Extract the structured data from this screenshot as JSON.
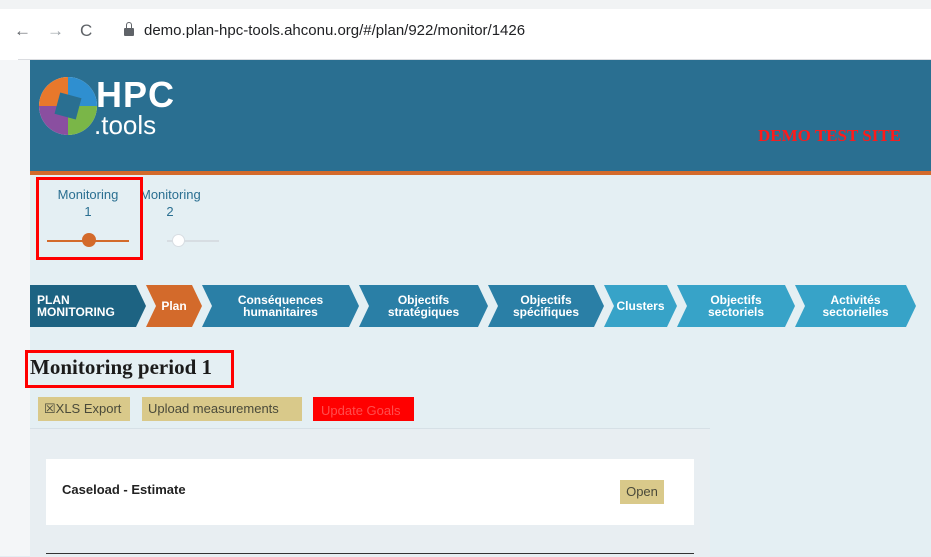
{
  "browser": {
    "url": "demo.plan-hpc-tools.ahconu.org/#/plan/922/monitor/1426",
    "back_icon": "←",
    "forward_icon": "→",
    "reload_icon": "C"
  },
  "header": {
    "logo_hpc": "HPC",
    "logo_tools": ".tools",
    "demo_banner": "DEMO TEST SITE"
  },
  "stepper": {
    "step1_label": "Monitoring",
    "step1_number": "1",
    "step2_label": "Monitoring",
    "step2_number": "2"
  },
  "breadcrumb": [
    {
      "label": "PLAN\nMONITORING",
      "color": "#1d6382"
    },
    {
      "label": "Plan",
      "color": "#d36a2b"
    },
    {
      "label": "Conséquences\nhumanitaires",
      "color": "#2a7fa6"
    },
    {
      "label": "Objectifs\nstratégiques",
      "color": "#2a7fa6"
    },
    {
      "label": "Objectifs\nspécifiques",
      "color": "#2a7fa6"
    },
    {
      "label": "Clusters",
      "color": "#37a3c8"
    },
    {
      "label": "Objectifs\nsectoriels",
      "color": "#37a3c8"
    },
    {
      "label": "Activités\nsectorielles",
      "color": "#37a3c8"
    }
  ],
  "main": {
    "title": "Monitoring period 1",
    "xls_export": "☒XLS Export",
    "upload_measurements": "Upload measurements",
    "update_goals": "Update Goals",
    "card_title": "Caseload - Estimate",
    "open_button": "Open"
  },
  "colors": {
    "header": "#2a6f91",
    "accent": "#d36a2b",
    "highlight": "#ff0000"
  }
}
